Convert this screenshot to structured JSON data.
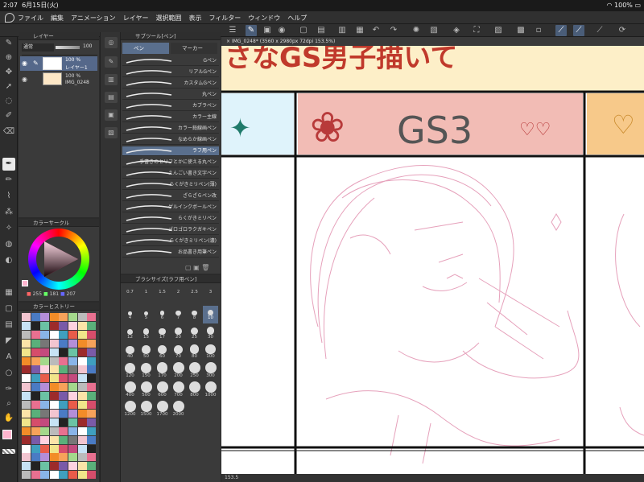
{
  "status_bar": {
    "time": "2:07",
    "date": "6月15日(火)",
    "battery": "100%"
  },
  "menu": [
    "ファイル",
    "編集",
    "アニメーション",
    "レイヤー",
    "選択範囲",
    "表示",
    "フィルター",
    "ウィンドウ",
    "ヘルプ"
  ],
  "layer_panel": {
    "title": "レイヤー",
    "blend_mode": "通常",
    "opacity": "100",
    "layers": [
      {
        "percent": "100 %",
        "name": "レイヤー1"
      },
      {
        "percent": "100 %",
        "name": "IMG_0248"
      }
    ]
  },
  "color_panel": {
    "title": "カラーサークル",
    "r": "255",
    "g": "181",
    "b": "207",
    "current_color": "#ffb5cf"
  },
  "history_panel": {
    "title": "カラーヒストリー"
  },
  "subtool_panel": {
    "title": "サブツール[ペン]",
    "tabs": [
      "ペン",
      "マーカー"
    ],
    "items": [
      "Gペン",
      "リアルGペン",
      "カスタムGペン",
      "丸ペン",
      "カブラペン",
      "カラー主線",
      "カラー鉛線画ペン",
      "なめらか線画ペン",
      "ラフ用ペン",
      "手書きのセリフとかに使える丸ペン",
      "えんごい書き文字ペン",
      "らくがきミリペン(薄)",
      "ざらざらペン改",
      "ゲルインクボールペン",
      "らくがきミリペン",
      "ゴロゴロラクガキペン",
      "らくがきミリペン(濃)",
      "お品書き用筆ペン"
    ],
    "selected": "ラフ用ペン"
  },
  "brush_panel": {
    "title": "ブラシサイズ[ラフ用ペン]",
    "sizes": [
      "0.7",
      "1",
      "1.5",
      "2",
      "2.5",
      "3",
      "4",
      "5",
      "6",
      "7",
      "8",
      "10",
      "12",
      "15",
      "17",
      "20",
      "25",
      "30",
      "40",
      "50",
      "60",
      "70",
      "80",
      "100",
      "120",
      "150",
      "170",
      "200",
      "250",
      "300",
      "400",
      "500",
      "600",
      "700",
      "800",
      "1000",
      "1200",
      "1500",
      "1700",
      "2000"
    ],
    "selected": "10"
  },
  "document": {
    "tab": "IMG_0248* (3560 x 2980px 72dpi 153.5%)",
    "zoom": "153.5",
    "header_text": "さなGS男子描いて",
    "panel_label": "GS3"
  }
}
